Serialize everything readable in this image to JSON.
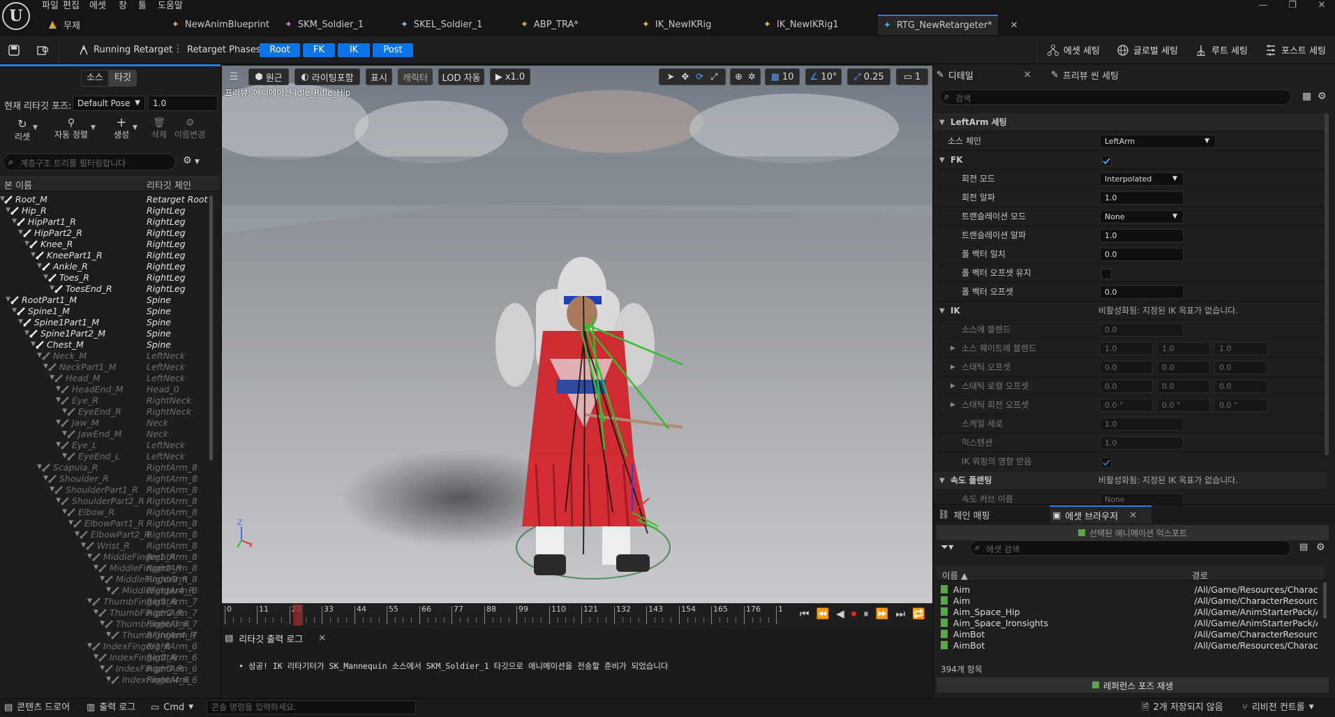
{
  "menu": [
    "파일",
    "편집",
    "에셋",
    "창",
    "툴",
    "도움말"
  ],
  "project_name": "무제",
  "doc_tabs": [
    {
      "label": "NewAnimBlueprint",
      "icon": "anim-blueprint-icon"
    },
    {
      "label": "SKM_Soldier_1",
      "icon": "skeletal-mesh-icon"
    },
    {
      "label": "SKEL_Soldier_1",
      "icon": "skeleton-icon"
    },
    {
      "label": "ABP_TRA*",
      "icon": "anim-blueprint-icon"
    },
    {
      "label": "IK_NewIKRig",
      "icon": "ik-rig-icon"
    },
    {
      "label": "IK_NewIKRig1",
      "icon": "ik-rig-icon"
    },
    {
      "label": "RTG_NewRetargeter*",
      "icon": "retargeter-icon"
    }
  ],
  "toolbar": {
    "running": "Running Retarget",
    "phases_label": "Retarget Phases:",
    "phases": [
      "Root",
      "FK",
      "IK",
      "Post"
    ],
    "right_buttons": [
      "에셋 세팅",
      "글로벌 세팅",
      "루트 세팅",
      "포스트 세팅"
    ]
  },
  "left": {
    "seg": [
      "소스",
      "타깃"
    ],
    "pose_label": "현재 리타깃 포즈:",
    "pose_value": "Default Pose",
    "pose_blend": "1.0",
    "tools": [
      "리셋",
      "자동 정렬",
      "생성",
      "삭제",
      "이름변경"
    ],
    "search_placeholder": "계층구조 트리를 필터링합니다",
    "col_bone": "본 이름",
    "col_chain": "리타깃 체인",
    "rows": [
      {
        "name": "Root_M",
        "chain": "Retarget Root",
        "d": 0,
        "dim": false
      },
      {
        "name": "Hip_R",
        "chain": "RightLeg",
        "d": 1,
        "dim": false
      },
      {
        "name": "HipPart1_R",
        "chain": "RightLeg",
        "d": 2,
        "dim": false
      },
      {
        "name": "HipPart2_R",
        "chain": "RightLeg",
        "d": 3,
        "dim": false
      },
      {
        "name": "Knee_R",
        "chain": "RightLeg",
        "d": 4,
        "dim": false
      },
      {
        "name": "KneePart1_R",
        "chain": "RightLeg",
        "d": 5,
        "dim": false
      },
      {
        "name": "Ankle_R",
        "chain": "RightLeg",
        "d": 6,
        "dim": false
      },
      {
        "name": "Toes_R",
        "chain": "RightLeg",
        "d": 7,
        "dim": false
      },
      {
        "name": "ToesEnd_R",
        "chain": "RightLeg",
        "d": 8,
        "dim": false
      },
      {
        "name": "RootPart1_M",
        "chain": "Spine",
        "d": 1,
        "dim": false
      },
      {
        "name": "Spine1_M",
        "chain": "Spine",
        "d": 2,
        "dim": false
      },
      {
        "name": "Spine1Part1_M",
        "chain": "Spine",
        "d": 3,
        "dim": false
      },
      {
        "name": "Spine1Part2_M",
        "chain": "Spine",
        "d": 4,
        "dim": false
      },
      {
        "name": "Chest_M",
        "chain": "Spine",
        "d": 5,
        "dim": false
      },
      {
        "name": "Neck_M",
        "chain": "LeftNeck",
        "d": 6,
        "dim": true
      },
      {
        "name": "NeckPart1_M",
        "chain": "LeftNeck",
        "d": 7,
        "dim": true
      },
      {
        "name": "Head_M",
        "chain": "LeftNeck",
        "d": 8,
        "dim": true
      },
      {
        "name": "HeadEnd_M",
        "chain": "Head_0",
        "d": 9,
        "dim": true
      },
      {
        "name": "Eye_R",
        "chain": "RightNeck",
        "d": 9,
        "dim": true
      },
      {
        "name": "EyeEnd_R",
        "chain": "RightNeck",
        "d": 10,
        "dim": true
      },
      {
        "name": "Jaw_M",
        "chain": "Neck",
        "d": 9,
        "dim": true
      },
      {
        "name": "JawEnd_M",
        "chain": "Neck",
        "d": 10,
        "dim": true
      },
      {
        "name": "Eye_L",
        "chain": "LeftNeck",
        "d": 9,
        "dim": true
      },
      {
        "name": "EyeEnd_L",
        "chain": "LeftNeck",
        "d": 10,
        "dim": true
      },
      {
        "name": "Scapula_R",
        "chain": "RightArm_8",
        "d": 6,
        "dim": true
      },
      {
        "name": "Shoulder_R",
        "chain": "RightArm_8",
        "d": 7,
        "dim": true
      },
      {
        "name": "ShoulderPart1_R",
        "chain": "RightArm_8",
        "d": 8,
        "dim": true
      },
      {
        "name": "ShoulderPart2_R",
        "chain": "RightArm_8",
        "d": 9,
        "dim": true
      },
      {
        "name": "Elbow_R",
        "chain": "RightArm_8",
        "d": 10,
        "dim": true
      },
      {
        "name": "ElbowPart1_R",
        "chain": "RightArm_8",
        "d": 11,
        "dim": true
      },
      {
        "name": "ElbowPart2_R",
        "chain": "RightArm_8",
        "d": 12,
        "dim": true
      },
      {
        "name": "Wrist_R",
        "chain": "RightArm_8",
        "d": 13,
        "dim": true
      },
      {
        "name": "MiddleFinger1_R",
        "chain": "RightArm_8",
        "d": 14,
        "dim": true
      },
      {
        "name": "MiddleFinger2_R",
        "chain": "RightArm_8",
        "d": 15,
        "dim": true
      },
      {
        "name": "MiddleFinger3_R",
        "chain": "RightArm_8",
        "d": 16,
        "dim": true
      },
      {
        "name": "MiddleFinger4_R",
        "chain": "RightArm_8",
        "d": 17,
        "dim": true
      },
      {
        "name": "ThumbFinger1_R",
        "chain": "RightArm_7",
        "d": 14,
        "dim": true
      },
      {
        "name": "ThumbFinger2_R",
        "chain": "RightArm_7",
        "d": 15,
        "dim": true
      },
      {
        "name": "ThumbFinger3_R",
        "chain": "RightArm_7",
        "d": 16,
        "dim": true
      },
      {
        "name": "ThumbFinger4_R",
        "chain": "RightArm_7",
        "d": 17,
        "dim": true
      },
      {
        "name": "IndexFinger1_R",
        "chain": "RightArm_6",
        "d": 14,
        "dim": true
      },
      {
        "name": "IndexFinger2_R",
        "chain": "RightArm_6",
        "d": 15,
        "dim": true
      },
      {
        "name": "IndexFinger3_R",
        "chain": "RightArm_6",
        "d": 16,
        "dim": true
      },
      {
        "name": "IndexFinger4_R",
        "chain": "RightArm_6",
        "d": 17,
        "dim": true
      }
    ]
  },
  "viewport": {
    "buttons": [
      "원근",
      "라이팅포함",
      "표시",
      "캐릭터",
      "LOD 자동",
      "x1.0"
    ],
    "grid_snap": "10",
    "rot_snap": "10°",
    "scale_snap": "0.25",
    "cam_speed": "1",
    "preview_label": "프리뷰: 애니메이션 Idle_Rifle_Hip"
  },
  "timeline": {
    "ticks": [
      "0",
      "11",
      "22",
      "33",
      "44",
      "55",
      "66",
      "77",
      "88",
      "99",
      "110",
      "121",
      "132",
      "143",
      "154",
      "165",
      "176",
      "1"
    ],
    "current": "22"
  },
  "log": {
    "title": "리타깃 출력 로그",
    "message": "성공! IK 리타기터가 SK_Mannequin 소스에서 SKM_Soldier_1 타깃으로 애니메이션을 전송할 준비가 되었습니다"
  },
  "details": {
    "tab_details": "디테일",
    "tab_preview": "프리뷰 씬 세팅",
    "search_placeholder": "검색",
    "section_leftarm": "LeftArm 세팅",
    "source_chain_label": "소스 체인",
    "source_chain_value": "LeftArm",
    "fk_label": "FK",
    "fk_rows": [
      {
        "label": "회전 모드",
        "value": "Interpolated",
        "kind": "dropdown"
      },
      {
        "label": "회전 알파",
        "value": "1.0",
        "kind": "number"
      },
      {
        "label": "트랜슬레이션 모드",
        "value": "None",
        "kind": "dropdown"
      },
      {
        "label": "트랜슬레이션 알파",
        "value": "1.0",
        "kind": "number"
      },
      {
        "label": "폴 벡터 일치",
        "value": "0.0",
        "kind": "number"
      },
      {
        "label": "폴 벡터 오프셋 유지",
        "value": "",
        "kind": "checkbox"
      },
      {
        "label": "폴 벡터 오프셋",
        "value": "0.0",
        "kind": "number"
      }
    ],
    "ik_label": "IK",
    "ik_disabled": "비활성화됨: 지정된 IK 목표가 없습니다.",
    "ik_rows": [
      {
        "label": "소스에 블렌드",
        "values": [
          "0.0"
        ]
      },
      {
        "label": "소스 웨이트에 블렌드",
        "values": [
          "1.0",
          "1.0",
          "1.0"
        ]
      },
      {
        "label": "스태틱 오프셋",
        "values": [
          "0.0",
          "0.0",
          "0.0"
        ]
      },
      {
        "label": "스태틱 로컬 오프셋",
        "values": [
          "0.0",
          "0.0",
          "0.0"
        ]
      },
      {
        "label": "스태틱 회전 오프셋",
        "values": [
          "0.0 °",
          "0.0 °",
          "0.0 °"
        ]
      },
      {
        "label": "스케일 세로",
        "values": [
          "1.0"
        ]
      },
      {
        "label": "익스텐션",
        "values": [
          "1.0"
        ]
      },
      {
        "label": "IK 워핑의 영향 받음",
        "values": []
      }
    ],
    "speed_label": "속도 플랜팅",
    "speed_disabled": "비활성화됨: 지정된 IK 목표가 없습니다.",
    "speed_curve_label": "속도 커브 이름",
    "speed_curve_value": "None"
  },
  "chain_tabs": {
    "chain": "체인 매핑",
    "browser": "에셋 브라우저"
  },
  "browser": {
    "export": "선택된 애니메이션 익스포트",
    "search_placeholder": "에셋 검색",
    "col_name": "이름",
    "col_path": "경로",
    "rows": [
      {
        "name": "Aim",
        "path": "/All/Game/Resources/Characte"
      },
      {
        "name": "Aim",
        "path": "/All/Game/CharacterResources"
      },
      {
        "name": "Aim_Space_Hip",
        "path": "/All/Game/AnimStarterPack/Air"
      },
      {
        "name": "Aim_Space_Ironsights",
        "path": "/All/Game/AnimStarterPack/Air"
      },
      {
        "name": "AimBot",
        "path": "/All/Game/CharacterResources"
      },
      {
        "name": "AimBot",
        "path": "/All/Game/Resources/Characte"
      }
    ],
    "count": "394개 항목",
    "play_ref": "레퍼런스 포즈 재생"
  },
  "statusbar": {
    "content_drawer": "콘텐츠 드로어",
    "output_log": "출력 로그",
    "cmd": "Cmd",
    "console_placeholder": "콘솔 명령을 입력하세요.",
    "unsaved": "2개 저장되지 않음",
    "revision": "리비전 컨트롤"
  },
  "colors": {
    "accent": "#0d74e7",
    "bg": "#151515",
    "panel": "#1e1e1e"
  }
}
